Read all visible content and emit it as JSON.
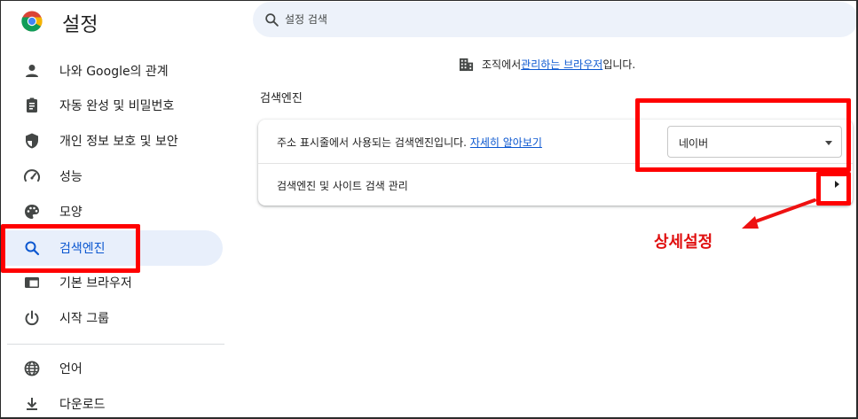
{
  "sidebar": {
    "title": "설정",
    "items": [
      {
        "label": "나와 Google의 관계",
        "icon": "person-icon"
      },
      {
        "label": "자동 완성 및 비밀번호",
        "icon": "clipboard-icon"
      },
      {
        "label": "개인 정보 보호 및 보안",
        "icon": "shield-icon"
      },
      {
        "label": "성능",
        "icon": "speedometer-icon"
      },
      {
        "label": "모양",
        "icon": "palette-icon"
      },
      {
        "label": "검색엔진",
        "icon": "search-icon",
        "selected": true
      },
      {
        "label": "기본 브라우저",
        "icon": "browser-icon"
      },
      {
        "label": "시작 그룹",
        "icon": "power-icon"
      },
      {
        "label": "언어",
        "icon": "globe-icon"
      },
      {
        "label": "다운로드",
        "icon": "download-icon"
      }
    ]
  },
  "search": {
    "placeholder": "설정 검색"
  },
  "managed_notice": {
    "prefix": "조직에서 ",
    "link": "관리하는 브라우저",
    "suffix": "입니다."
  },
  "section": {
    "title": "검색엔진"
  },
  "card": {
    "row1_text": "주소 표시줄에서 사용되는 검색엔진입니다.",
    "row1_link": "자세히 알아보기",
    "engine_selected": "네이버",
    "row2_text": "검색엔진 및 사이트 검색 관리"
  },
  "annotation": {
    "callout": "상세설정",
    "color": "#ff0000"
  },
  "colors": {
    "accent": "#0b57d0",
    "selected_bg": "#e8effb",
    "search_bg": "#edf2fa"
  }
}
